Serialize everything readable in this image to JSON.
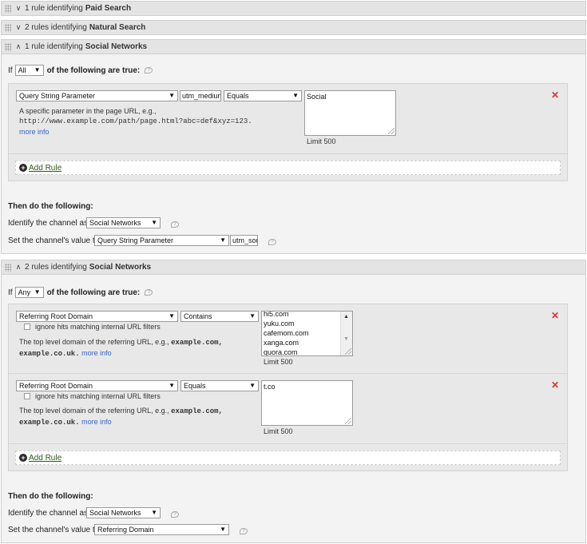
{
  "sections": [
    {
      "chevron": "∨",
      "prefix": "1 rule identifying",
      "name": "Paid Search"
    },
    {
      "chevron": "∨",
      "prefix": "2 rules identifying",
      "name": "Natural Search"
    },
    {
      "chevron": "∧",
      "prefix": "1 rule identifying",
      "name": "Social Networks"
    },
    {
      "chevron": "∧",
      "prefix": "2 rules identifying",
      "name": "Social Networks"
    }
  ],
  "common": {
    "if_label": "If",
    "of_following": "of the following are true:",
    "then_label": "Then do the following:",
    "identify_label": "Identify the channel as",
    "set_value_label": "Set the channel's value to",
    "add_rule": "Add Rule",
    "more_info": "more info",
    "remove_icon": "✕"
  },
  "panel1": {
    "match": "All",
    "rule": {
      "type": "Query String Parameter",
      "param": "utm_medium",
      "operator": "Equals",
      "value": "Social",
      "limit": "Limit 500",
      "desc_line1": "A specific parameter in the page URL, e.g.,",
      "desc_code": "http://www.example.com/path/page.html?abc=def&xyz=123."
    },
    "channel": "Social Networks",
    "value_source": "Query String Parameter",
    "value_param": "utm_source"
  },
  "panel2": {
    "match": "Any",
    "rule1": {
      "type": "Referring Root Domain",
      "operator": "Contains",
      "values": [
        "hi5.com",
        "yuku.com",
        "cafemom.com",
        "xanga.com",
        "quora.com"
      ],
      "limit": "Limit 500",
      "ignore": "ignore hits matching internal URL filters",
      "desc_text": "The top level domain of the referring URL, e.g.,",
      "desc_code1": "example.com,",
      "desc_code2": "example.co.uk."
    },
    "rule2": {
      "type": "Referring Root Domain",
      "operator": "Equals",
      "value": "t.co",
      "limit": "Limit 500",
      "ignore": "ignore hits matching internal URL filters",
      "desc_text": "The top level domain of the referring URL, e.g.,",
      "desc_code1": "example.com,",
      "desc_code2": "example.co.uk."
    },
    "channel": "Social Networks",
    "value_source": "Referring Domain"
  }
}
